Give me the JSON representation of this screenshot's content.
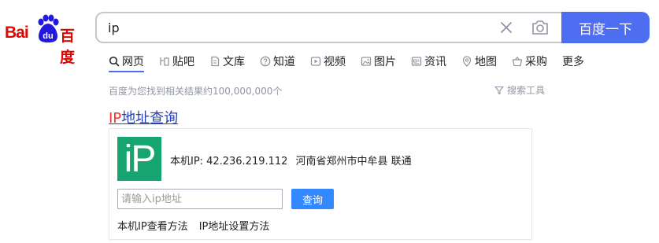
{
  "logo": {
    "latin": "Bai",
    "cn": "百度",
    "paw_text": "du",
    "color": "#e10601"
  },
  "search": {
    "value": "ip",
    "button_label": "百度一下",
    "accent": "#4e6ef2"
  },
  "tabs": [
    {
      "label": "网页",
      "icon": "search-icon",
      "active": true
    },
    {
      "label": "贴吧",
      "icon": "tieba-icon"
    },
    {
      "label": "文库",
      "icon": "doc-icon"
    },
    {
      "label": "知道",
      "icon": "question-icon"
    },
    {
      "label": "视频",
      "icon": "video-icon"
    },
    {
      "label": "图片",
      "icon": "image-icon"
    },
    {
      "label": "资讯",
      "icon": "news-icon"
    },
    {
      "label": "地图",
      "icon": "map-pin-icon"
    },
    {
      "label": "采购",
      "icon": "basket-icon"
    },
    {
      "label": "更多",
      "icon": ""
    }
  ],
  "results": {
    "count_text": "百度为您找到相关结果约100,000,000个",
    "tools_label": "搜索工具"
  },
  "result_title": {
    "highlight": "IP",
    "rest": "地址查询"
  },
  "ip_card": {
    "logo_text": "iP",
    "logo_color": "#16a571",
    "ip_label": "本机IP:",
    "ip_value": "42.236.219.112",
    "location": "河南省郑州市中牟县 联通",
    "input_placeholder": "请输入ip地址",
    "query_button": "查询",
    "links": [
      "本机IP查看方法",
      "IP地址设置方法"
    ]
  }
}
